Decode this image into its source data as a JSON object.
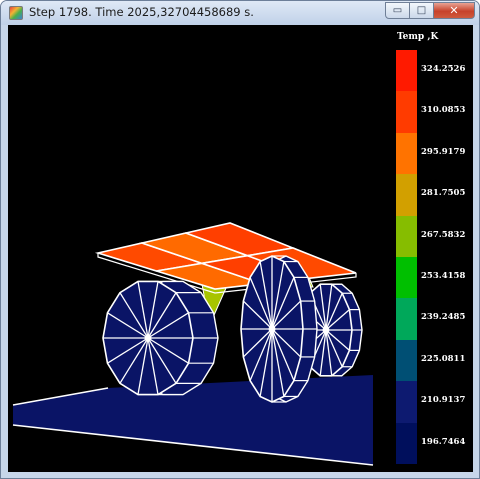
{
  "window": {
    "title": "Step 1798. Time 2025,32704458689 s.",
    "controls": {
      "minimize": "▭",
      "maximize": "□",
      "close": "✕"
    }
  },
  "legend": {
    "title": "Temp ,K",
    "labels": [
      "324.2526",
      "310.0853",
      "295.9179",
      "281.7505",
      "267.5832",
      "253.4158",
      "239.2485",
      "225.0811",
      "210.9137",
      "196.7464"
    ],
    "colors": [
      "#ff1a00",
      "#ff3b00",
      "#ff7300",
      "#d2a000",
      "#86bd00",
      "#00bf00",
      "#00a85a",
      "#004f74",
      "#0d1a70",
      "#000f5c"
    ]
  },
  "scene": {
    "background": "#000000",
    "ground_color": "#0a1466",
    "wheel_fill": "#0a1466",
    "wire_color": "#ffffff",
    "plate_colors": [
      "#ff4a00",
      "#ff6a00",
      "#ff3f00"
    ],
    "leg_color": "#a8c400"
  }
}
